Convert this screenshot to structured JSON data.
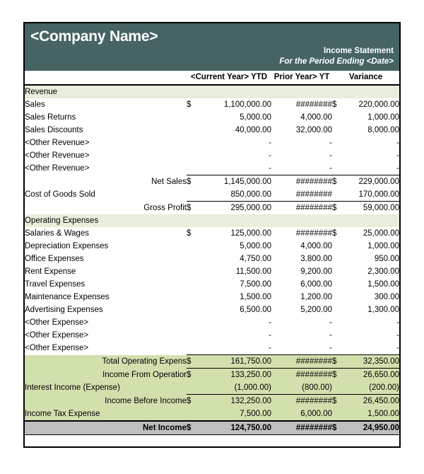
{
  "header": {
    "company_name": "<Company Name>",
    "statement_title": "Income Statement",
    "period_line": "For the Period Ending <Date>"
  },
  "columns": {
    "label": "",
    "current_year": "<Current Year> YTD",
    "prior_year": "Prior Year> YT",
    "variance": "Variance"
  },
  "currency_symbol": "$",
  "dash": "-",
  "sections": [
    {
      "title": "Revenue",
      "rows": [
        {
          "label": "Sales",
          "cur_sym": "$",
          "cur": "1,100,000.00",
          "prior": "########",
          "var_sym": "$",
          "var": "220,000.00"
        },
        {
          "label": "Sales Returns",
          "cur_sym": "",
          "cur": "5,000.00",
          "prior": "4,000.00",
          "var_sym": "",
          "var": "1,000.00"
        },
        {
          "label": "Sales Discounts",
          "cur_sym": "",
          "cur": "40,000.00",
          "prior": "32,000.00",
          "var_sym": "",
          "var": "8,000.00"
        },
        {
          "label": "<Other Revenue>",
          "cur_sym": "",
          "cur": "-",
          "prior": "-",
          "var_sym": "",
          "var": "-"
        },
        {
          "label": "<Other Revenue>",
          "cur_sym": "",
          "cur": "-",
          "prior": "-",
          "var_sym": "",
          "var": "-"
        },
        {
          "label": "<Other Revenue>",
          "cur_sym": "",
          "cur": "-",
          "prior": "-",
          "var_sym": "",
          "var": "-"
        },
        {
          "label": "Net Sales",
          "cur_sym": "$",
          "cur": "1,145,000.00",
          "prior": "########",
          "var_sym": "$",
          "var": "229,000.00"
        },
        {
          "label": "Cost of Goods Sold",
          "cur_sym": "",
          "cur": "850,000.00",
          "prior": "########",
          "var_sym": "",
          "var": "170,000.00"
        },
        {
          "label": "Gross Profit",
          "cur_sym": "$",
          "cur": "295,000.00",
          "prior": "########",
          "var_sym": "$",
          "var": "59,000.00"
        }
      ]
    },
    {
      "title": "Operating Expenses",
      "rows": [
        {
          "label": "Salaries & Wages",
          "cur_sym": "$",
          "cur": "125,000.00",
          "prior": "########",
          "var_sym": "$",
          "var": "25,000.00"
        },
        {
          "label": "Depreciation Expenses",
          "cur_sym": "",
          "cur": "5,000.00",
          "prior": "4,000.00",
          "var_sym": "",
          "var": "1,000.00"
        },
        {
          "label": "Office Expenses",
          "cur_sym": "",
          "cur": "4,750.00",
          "prior": "3,800.00",
          "var_sym": "",
          "var": "950.00"
        },
        {
          "label": "Rent Expense",
          "cur_sym": "",
          "cur": "11,500.00",
          "prior": "9,200.00",
          "var_sym": "",
          "var": "2,300.00"
        },
        {
          "label": "Travel Expenses",
          "cur_sym": "",
          "cur": "7,500.00",
          "prior": "6,000.00",
          "var_sym": "",
          "var": "1,500.00"
        },
        {
          "label": "Maintenance Expenses",
          "cur_sym": "",
          "cur": "1,500.00",
          "prior": "1,200.00",
          "var_sym": "",
          "var": "300.00"
        },
        {
          "label": "Advertising Expenses",
          "cur_sym": "",
          "cur": "6,500.00",
          "prior": "5,200.00",
          "var_sym": "",
          "var": "1,300.00"
        },
        {
          "label": "<Other Expense>",
          "cur_sym": "",
          "cur": "-",
          "prior": "-",
          "var_sym": "",
          "var": "-"
        },
        {
          "label": "<Other Expense>",
          "cur_sym": "",
          "cur": "-",
          "prior": "-",
          "var_sym": "",
          "var": "-"
        },
        {
          "label": "<Other Expense>",
          "cur_sym": "",
          "cur": "-",
          "prior": "-",
          "var_sym": "",
          "var": "-"
        }
      ]
    }
  ],
  "totals": [
    {
      "label": "Total Operating Expens",
      "cur_sym": "$",
      "cur": "161,750.00",
      "prior": "########",
      "var_sym": "$",
      "var": "32,350.00"
    },
    {
      "label": "Income From Operatior",
      "cur_sym": "$",
      "cur": "133,250.00",
      "prior": "########",
      "var_sym": "$",
      "var": "26,650.00"
    },
    {
      "label": "Interest Income (Expense)",
      "cur_sym": "",
      "cur": "(1,000.00)",
      "prior": "(800.00)",
      "var_sym": "",
      "var": "(200.00)"
    },
    {
      "label": "Income Before Income",
      "cur_sym": "$",
      "cur": "132,250.00",
      "prior": "########",
      "var_sym": "$",
      "var": "26,450.00"
    },
    {
      "label": "Income Tax Expense",
      "cur_sym": "",
      "cur": "7,500.00",
      "prior": "6,000.00",
      "var_sym": "",
      "var": "1,500.00"
    }
  ],
  "net_income": {
    "label": "Net Income",
    "cur_sym": "$",
    "cur": "124,750.00",
    "prior": "########",
    "var_sym": "$",
    "var": "24,950.00"
  }
}
